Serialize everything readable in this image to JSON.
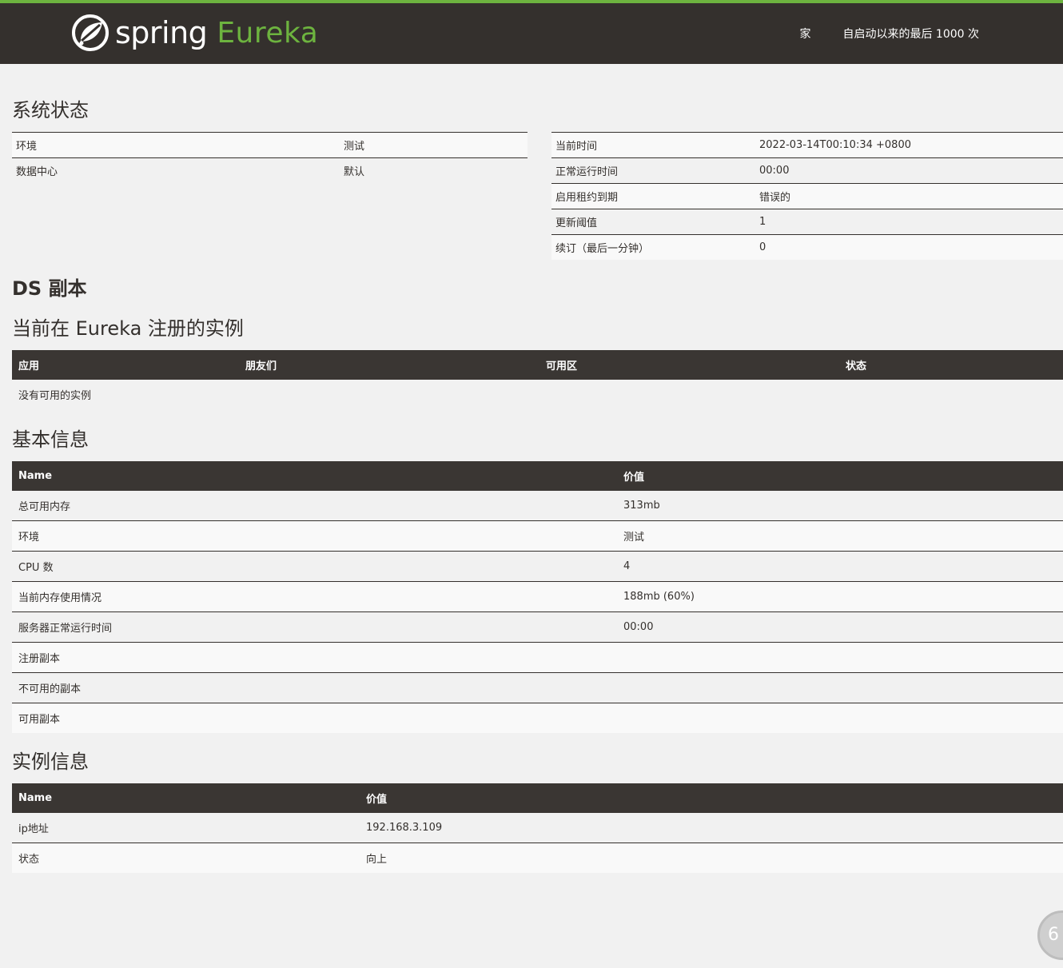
{
  "nav": {
    "brand_spring": "spring",
    "brand_eureka": "Eureka",
    "home": "家",
    "last_1000": "自启动以来的最后 1000 次"
  },
  "system_status": {
    "title": "系统状态",
    "left": [
      {
        "key": "环境",
        "value": "测试"
      },
      {
        "key": "数据中心",
        "value": "默认"
      }
    ],
    "right": [
      {
        "key": "当前时间",
        "value": "2022-03-14T00:10:34 +0800"
      },
      {
        "key": "正常运行时间",
        "value": "00:00"
      },
      {
        "key": "启用租约到期",
        "value": "错误的"
      },
      {
        "key": "更新阈值",
        "value": "1"
      },
      {
        "key": "续订（最后一分钟）",
        "value": "0"
      }
    ]
  },
  "ds_replicas": {
    "title": "DS 副本"
  },
  "instances": {
    "title": "当前在 Eureka 注册的实例",
    "headers": [
      "应用",
      "朋友们",
      "可用区",
      "状态"
    ],
    "empty": "没有可用的实例"
  },
  "general_info": {
    "title": "基本信息",
    "headers": [
      "Name",
      "价值"
    ],
    "rows": [
      {
        "name": "总可用内存",
        "value": "313mb"
      },
      {
        "name": "环境",
        "value": "测试"
      },
      {
        "name": "CPU 数",
        "value": "4"
      },
      {
        "name": "当前内存使用情况",
        "value": "188mb (60%)"
      },
      {
        "name": "服务器正常运行时间",
        "value": "00:00"
      },
      {
        "name": "注册副本",
        "value": ""
      },
      {
        "name": "不可用的副本",
        "value": ""
      },
      {
        "name": "可用副本",
        "value": ""
      }
    ]
  },
  "instance_info": {
    "title": "实例信息",
    "headers": [
      "Name",
      "价值"
    ],
    "rows": [
      {
        "name": "ip地址",
        "value": "192.168.3.109"
      },
      {
        "name": "状态",
        "value": "向上"
      }
    ]
  },
  "badge": {
    "text": "6"
  },
  "colors": {
    "brand_green": "#6db33f",
    "nav_bg": "#34302d",
    "page_bg": "#f1f1f1"
  }
}
